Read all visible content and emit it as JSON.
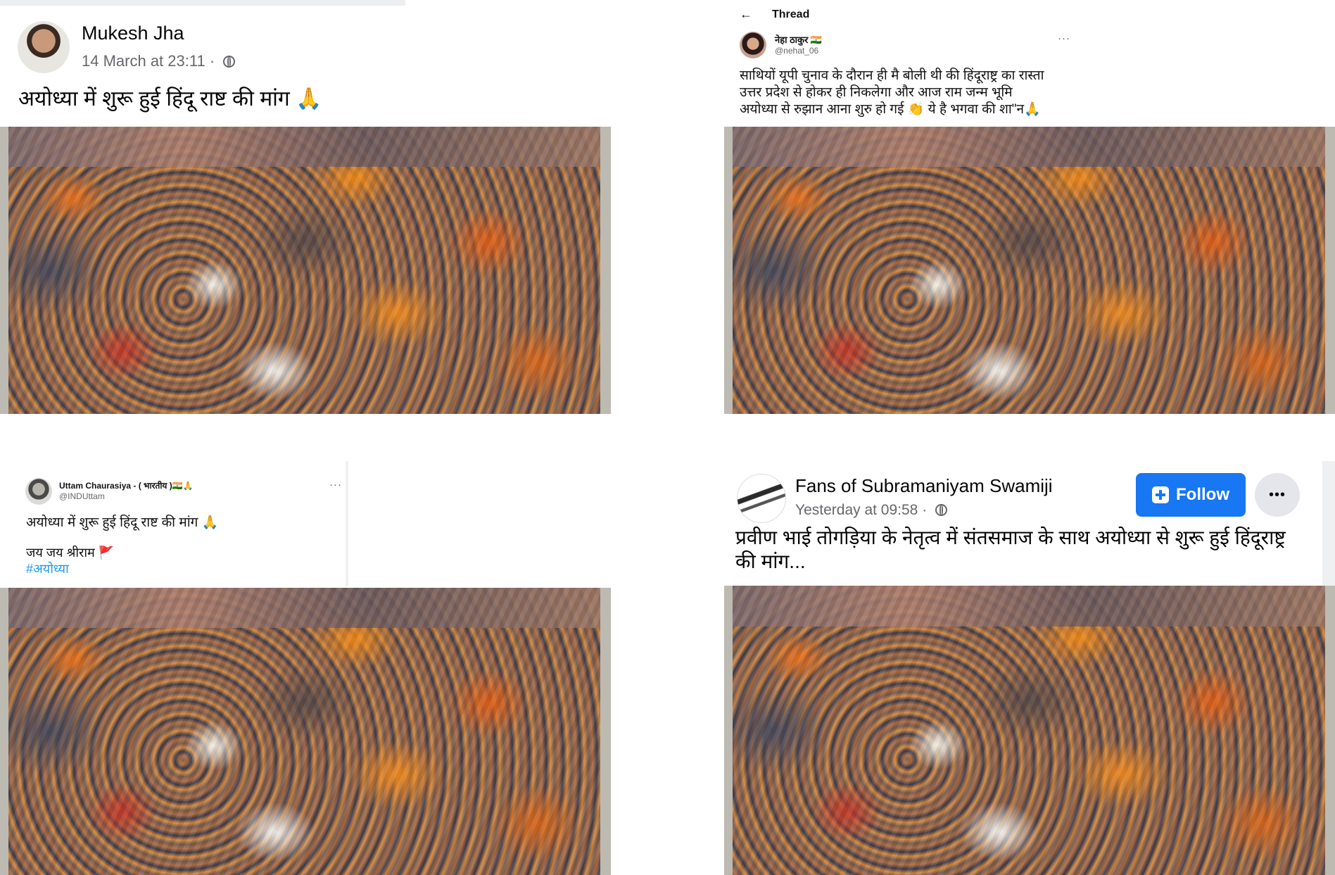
{
  "post1": {
    "author": "Mukesh Jha",
    "timestamp": "14 March at 23:11",
    "separator": "·",
    "privacy_icon": "globe-icon",
    "text": "अयोध्या में शुरू हुई हिंदू राष्ट की मांग 🙏"
  },
  "post2": {
    "back_icon": "arrow-left-icon",
    "header_title": "Thread",
    "author": "नेहा ठाकुर 🇮🇳",
    "handle": "@nehat_06",
    "more": "···",
    "lines": [
      "साथियों यूपी चुनाव के दौरान ही मै बोली थी की हिंदूराष्ट्र का रास्ता",
      "उत्तर प्रदेश से होकर ही निकलेगा और आज राम जन्म भूमि",
      "अयोध्या से रुझान आना शुरु हो गई 👏 ये है भगवा की शा\"न🙏"
    ]
  },
  "post3": {
    "author": "Uttam Chaurasiya - ( भारतीय )🇮🇳🙏",
    "handle": "@INDUttam",
    "more": "···",
    "text": "अयोध्या में शुरू हुई हिंदू राष्ट की मांग 🙏",
    "line2": "जय जय श्रीराम 🚩",
    "hashtag": "#अयोध्या",
    "hashtag_color": "#1d9bf0"
  },
  "post4": {
    "author": "Fans of Subramaniyam Swamiji",
    "timestamp": "Yesterday at 09:58",
    "separator": "·",
    "privacy_icon": "globe-icon",
    "follow_label": "Follow",
    "follow_color": "#1877f2",
    "more": "•••",
    "lines": [
      "प्रवीण भाई तोगड़िया के नेतृत्व में संतसमाज के साथ अयोध्या से शुरू हुई हिंदूराष्ट्र",
      "की मांग..."
    ]
  }
}
